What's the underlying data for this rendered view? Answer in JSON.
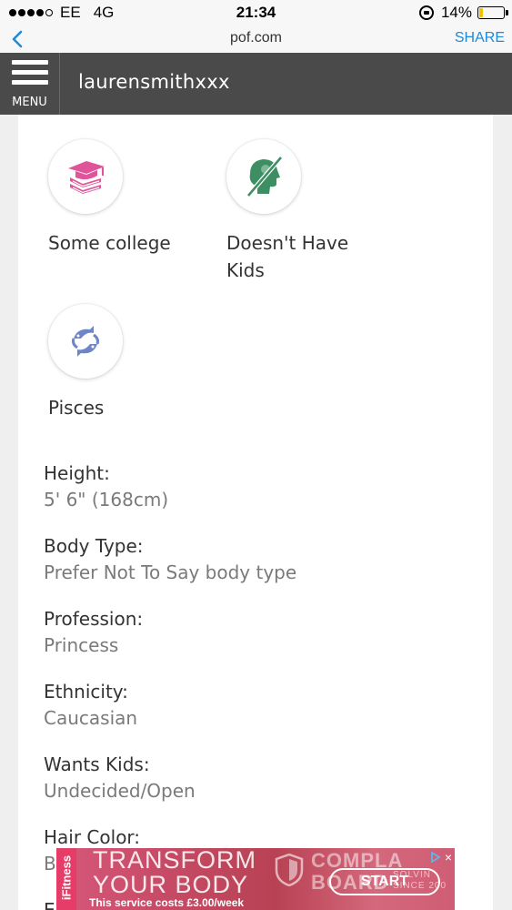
{
  "status_bar": {
    "carrier": "EE",
    "network": "4G",
    "time": "21:34",
    "battery": "14%",
    "battery_level": 0.14
  },
  "browser": {
    "url": "pof.com",
    "share_label": "SHARE",
    "back_icon": "chevron-left-icon"
  },
  "header": {
    "menu_label": "MENU",
    "username": "laurensmithxxx"
  },
  "badges": [
    {
      "label": "Some college",
      "icon": "graduation-books-icon",
      "color": "#e0559a"
    },
    {
      "label": "Doesn't Have\nKids",
      "icon": "no-kids-icon",
      "color": "#3d8f63"
    },
    {
      "label": "Pisces",
      "icon": "pisces-fish-icon",
      "color": "#6f86c6"
    }
  ],
  "details": [
    {
      "label": "Height:",
      "value": "5' 6\" (168cm)"
    },
    {
      "label": "Body Type:",
      "value": "Prefer Not To Say body type"
    },
    {
      "label": "Profession:",
      "value": "Princess"
    },
    {
      "label": "Ethnicity:",
      "value": "Caucasian"
    },
    {
      "label": "Wants Kids:",
      "value": "Undecided/Open"
    },
    {
      "label": "Hair Color:",
      "value": "B"
    },
    {
      "label": "E"
    }
  ],
  "ad": {
    "side_text": "iFitness",
    "headline_1": "TRANSFORM",
    "headline_2": "YOUR BODY",
    "subtext": "This service costs £3.00/week",
    "brand_1": "COMPLA",
    "brand_2": "BOARD",
    "small_1": "SOLVIN",
    "small_2": "SINCE 200",
    "cta": "START",
    "close": "×"
  }
}
